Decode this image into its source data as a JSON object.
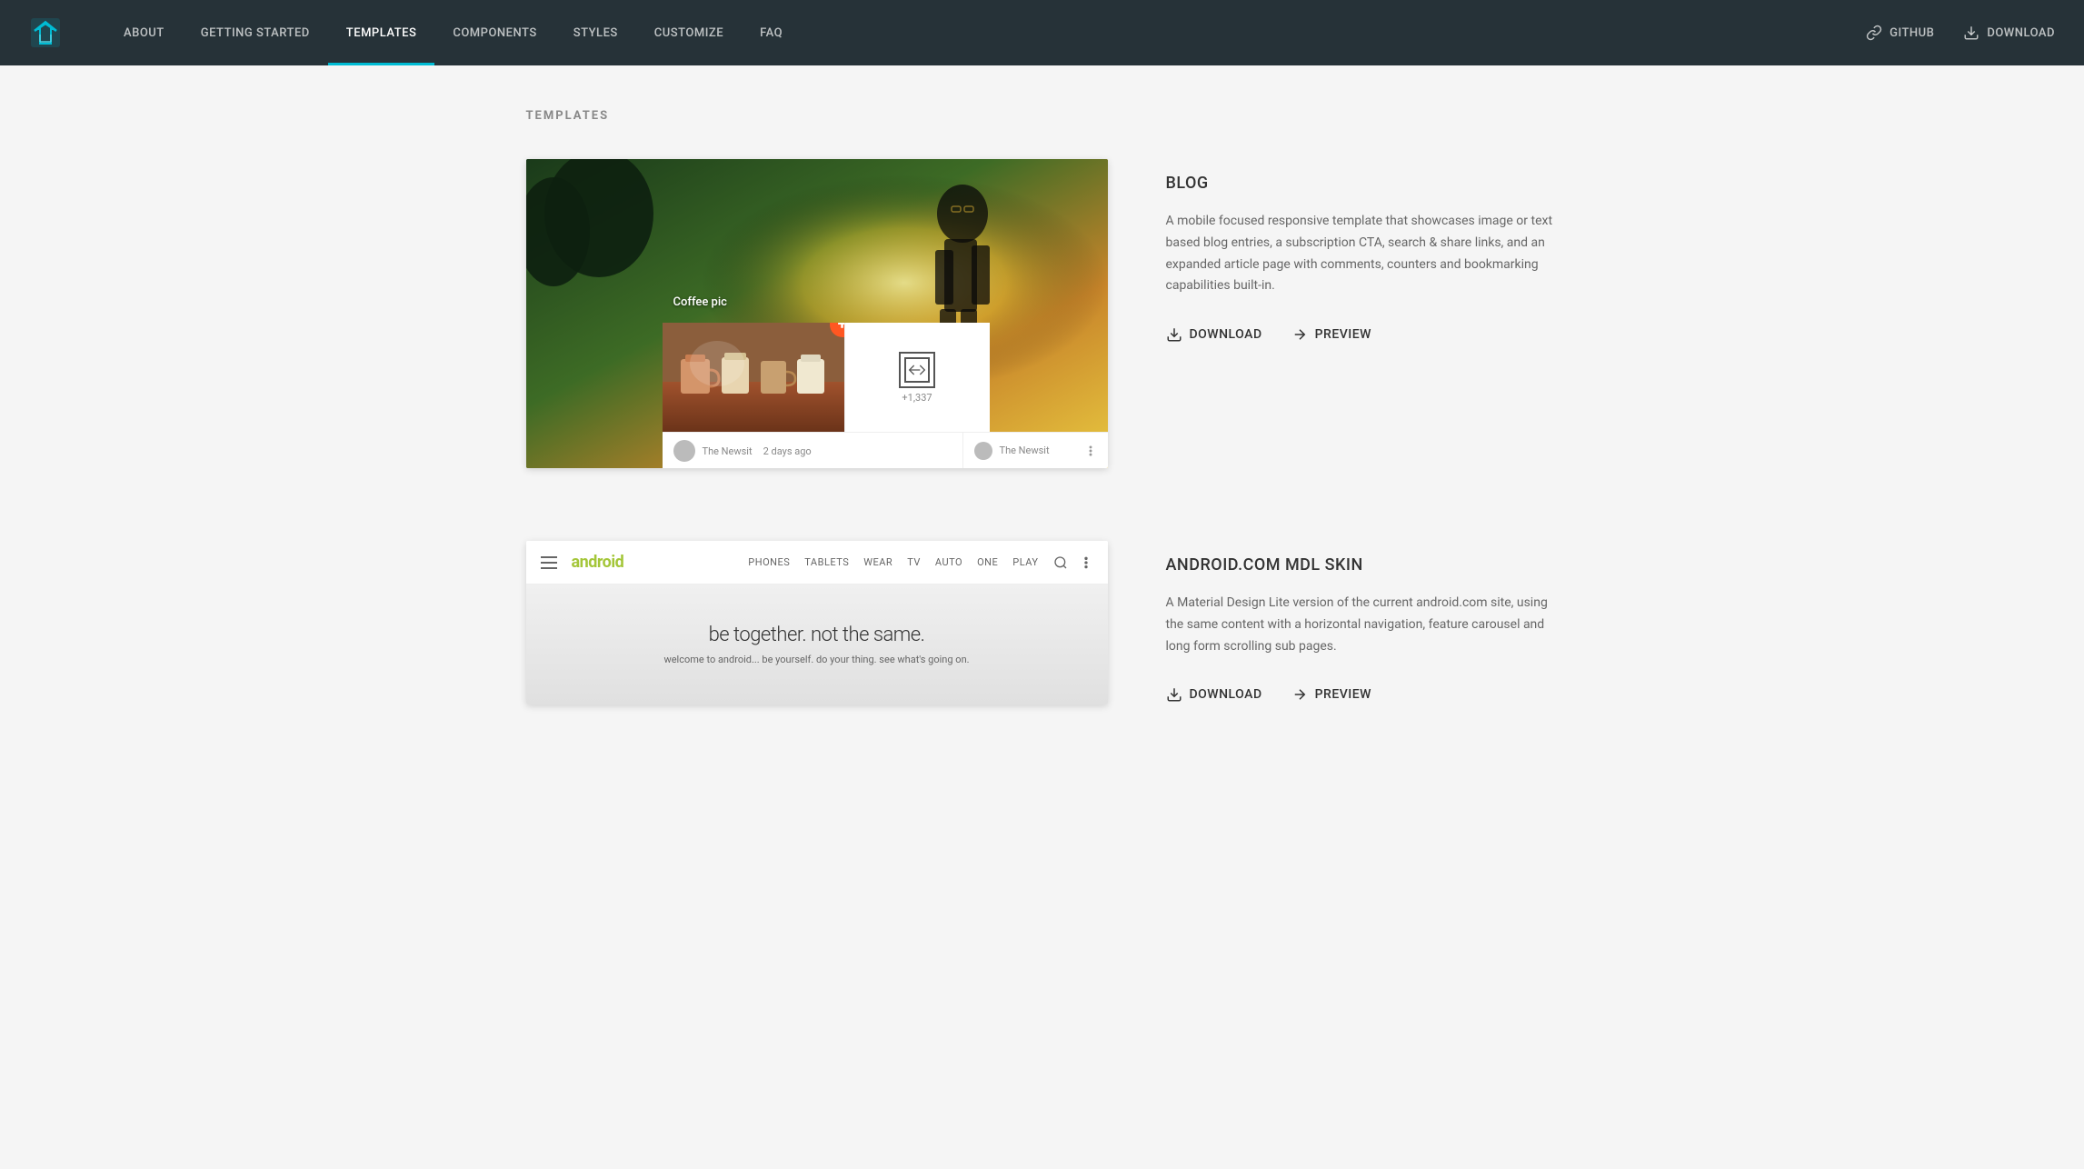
{
  "header": {
    "logo_alt": "MDL Logo",
    "nav_items": [
      {
        "label": "ABOUT",
        "active": false
      },
      {
        "label": "GETTING STARTED",
        "active": false
      },
      {
        "label": "TEMPLATES",
        "active": true
      },
      {
        "label": "COMPONENTS",
        "active": false
      },
      {
        "label": "STYLES",
        "active": false
      },
      {
        "label": "CUSTOMIZE",
        "active": false
      },
      {
        "label": "FAQ",
        "active": false
      }
    ],
    "github_label": "GitHub",
    "download_label": "Download"
  },
  "page": {
    "title": "TEMPLATES"
  },
  "templates": [
    {
      "id": "blog",
      "name": "BLOG",
      "description": "A mobile focused responsive template that showcases image or text based blog entries, a subscription CTA, search & share links, and an expanded article page with comments, counters and bookmarking capabilities built-in.",
      "download_label": "Download",
      "preview_label": "Preview",
      "preview_caption": "Coffee pic",
      "preview_count": "+1,337",
      "preview_post": "The Newsit",
      "preview_post_date": "2 days ago"
    },
    {
      "id": "android",
      "name": "ANDROID.COM MDL SKIN",
      "description": "A Material Design Lite version of the current android.com site, using the same content with a horizontal navigation, feature carousel and long form scrolling sub pages.",
      "download_label": "Download",
      "preview_label": "Preview",
      "android_logo": "android",
      "android_nav_links": [
        "PHONES",
        "TABLETS",
        "WEAR",
        "TV",
        "AUTO",
        "ONE",
        "PLAY"
      ],
      "android_tagline": "be together. not the same.",
      "android_sub": "welcome to android... be yourself. do your thing. see what's going on."
    }
  ]
}
